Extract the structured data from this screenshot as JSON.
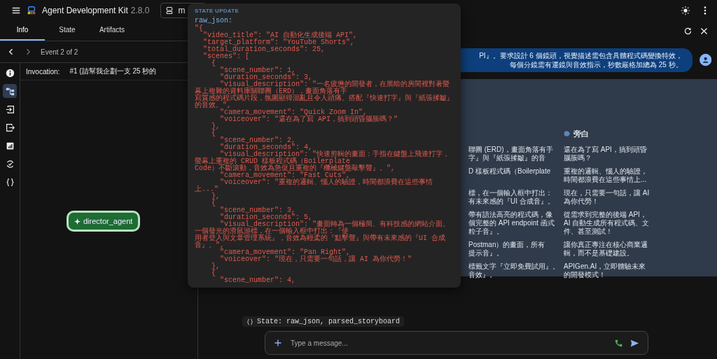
{
  "app": {
    "title": "Agent Development Kit",
    "version": "2.8.0",
    "agent_selector": {
      "value": "m"
    }
  },
  "tabs": [
    {
      "label": "Info",
      "selected": true
    },
    {
      "label": "State",
      "selected": false
    },
    {
      "label": "Artifacts",
      "selected": false
    }
  ],
  "event_nav": {
    "label": "Event 2 of 2"
  },
  "side_icons": [
    {
      "kind": "info",
      "selected": false
    },
    {
      "kind": "graph",
      "selected": true
    },
    {
      "kind": "input",
      "selected": false
    },
    {
      "kind": "output",
      "selected": false
    },
    {
      "kind": "chart",
      "selected": false
    },
    {
      "kind": "sync",
      "selected": false
    },
    {
      "kind": "braces",
      "selected": false
    }
  ],
  "invocation": {
    "label": "Invocation:",
    "value": "#1 (請幫我企劃一支 25 秒的"
  },
  "graph_nodes": [
    {
      "label": "director_agent"
    }
  ],
  "state_popup": {
    "heading": "STATE UPDATE",
    "key": "raw_json:",
    "lines": [
      "\"{",
      "  \"video_title\": \"AI 自動化生成後端 API\",",
      "  \"target_platform\": \"YouTube Shorts\",",
      "  \"total_duration_seconds\": 25,",
      "  \"scenes\": [",
      "    {",
      "      \"scene_number\": 1,",
      "      \"duration_seconds\": 3,",
      "      \"visual_description\": \"一名疲憊的開發者，在黑暗的房間裡對著螢幕上複雜的資料庫關聯圖（ERD），畫面角落有手",
      "寫質感的程式碼片段，氛圍顯得混亂且令人頭痛。搭配『快速打字』與『紙張揉皺』的音效。\",",
      "      \"camera_movement\": \"Quick Zoom In\",",
      "      \"voiceover\": \"還在為了寫 API，搞到頭昏腦脹嗎？\"",
      "    },",
      "    {",
      "      \"scene_number\": 2,",
      "      \"duration_seconds\": 4,",
      "      \"visual_description\": \"快速剪輯的畫面：手指在鍵盤上飛速打字，螢幕上重複的 CRUD 樣板程式碼（Boilerplate",
      "Code）不斷滾動，音效為急促且重複的『機械鍵盤敲擊聲』。\",",
      "      \"camera_movement\": \"Fast Cuts\",",
      "      \"voiceover\": \"重複的邏輯、惱人的驗證，時間都浪費在這些事情上...\"",
      "    },",
      "    {",
      "      \"scene_number\": 3,",
      "      \"duration_seconds\": 5,",
      "      \"visual_description\": \"畫面轉為一個極簡、有科技感的網站介面。一個發光的滑鼠游標，在一個輸入框中打出：『使",
      "用者登入與文章管理系統』，音效為輕柔的『點擊聲』與帶有未來感的『UI 合成音』。\",",
      "      \"camera_movement\": \"Pan Right\",",
      "      \"voiceover\": \"現在，只需要一句話，讓 AI 為你代勞！\"",
      "    },",
      "    {",
      "      \"scene_number\": 4,"
    ]
  },
  "user_message": {
    "text": "PI』。要求設計 6 個鏡頭，視覺描述需包含具體程式碼變換特效，每個分鏡需有運鏡與音效指示，秒數嚴格加總為 25 秒。"
  },
  "storyboard_table": {
    "narration_header": "旁白",
    "rows": [
      {
        "column_1": [
          "聯圖 (ERD)，畫面角落有手",
          "字』與『紙張揉皺』的音"
        ],
        "narration": "還在為了寫 API，搞到頭昏腦脹嗎？"
      },
      {
        "column_1": [
          "D 樣板程式碼（Boilerplate"
        ],
        "narration": "重複的邏輯、惱人的驗證，時間都浪費在這些事情上..."
      },
      {
        "column_1": [
          "標，在一個輸入框中打出：",
          "有未來感的『UI 合成音』。"
        ],
        "narration": "現在，只需要一句話，讓 AI 為你代勞！"
      },
      {
        "column_1": [
          "帶有語法高亮的程式碼，像",
          "個完整的 API endpoint 函式",
          "粒子音』。"
        ],
        "narration": "從需求到完整的後端 API，AI 自動生成所有程式碼、文件、甚至測試！"
      },
      {
        "column_1": [
          "Postman）的畫面，所有",
          "提示音』。"
        ],
        "narration": "讓你真正專注在核心商業邏輯，而不是基礎建設。"
      },
      {
        "column_1": [
          "標籤文字『立即免費試用』。",
          "音效』。"
        ],
        "narration": "APIGen.AI，立即體驗未來的開發模式！"
      }
    ]
  },
  "state_chip": {
    "text": "State: raw_json, parsed_storyboard"
  },
  "composer": {
    "placeholder": "Type a message..."
  }
}
